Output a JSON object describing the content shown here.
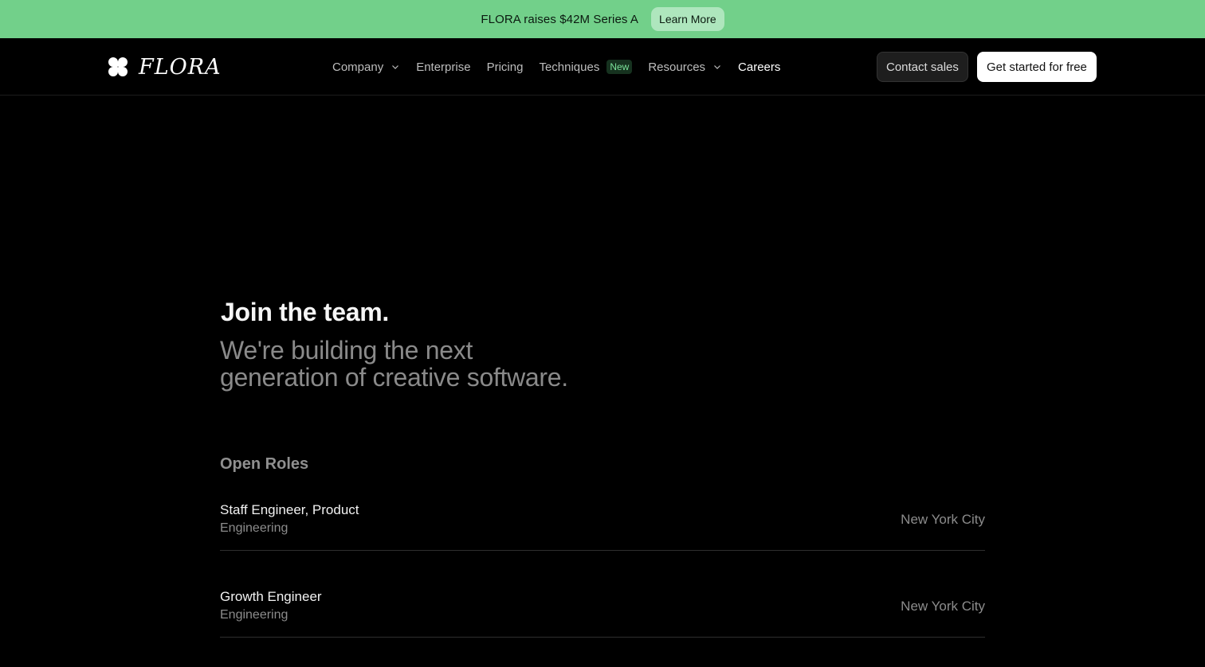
{
  "announcement": {
    "text": "FLORA raises $42M Series A",
    "button_label": "Learn More",
    "bar_color": "#72d08a"
  },
  "header": {
    "logo": {
      "icon": "four-petal-logo-icon",
      "wordmark": "FLORA"
    },
    "nav": [
      {
        "label": "Company",
        "has_dropdown": true
      },
      {
        "label": "Enterprise",
        "has_dropdown": false
      },
      {
        "label": "Pricing",
        "has_dropdown": false
      },
      {
        "label": "Techniques",
        "has_dropdown": false,
        "badge": "New"
      },
      {
        "label": "Resources",
        "has_dropdown": true
      },
      {
        "label": "Careers",
        "has_dropdown": false,
        "active": true
      }
    ],
    "contact_label": "Contact sales",
    "get_started_label": "Get started for free"
  },
  "hero": {
    "title": "Join the team.",
    "subtitle_line1": "We're building the next",
    "subtitle_line2": "generation of creative software."
  },
  "roles": {
    "heading": "Open Roles",
    "items": [
      {
        "title": "Staff Engineer, Product",
        "department": "Engineering",
        "location": "New York City"
      },
      {
        "title": "Growth Engineer",
        "department": "Engineering",
        "location": "New York City"
      }
    ]
  }
}
